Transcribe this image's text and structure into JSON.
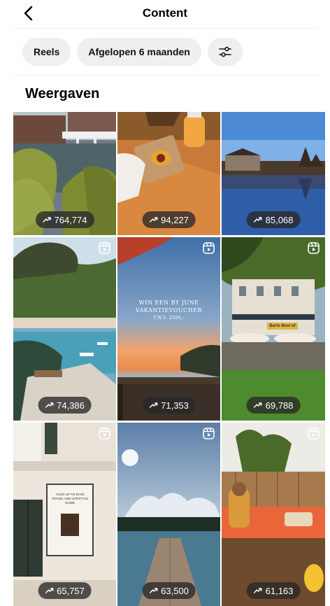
{
  "header": {
    "title": "Content",
    "back_icon": "chevron-left-icon"
  },
  "filters": {
    "content_type": "Reels",
    "period": "Afgelopen 6 maanden",
    "settings_icon": "sliders-icon"
  },
  "section": {
    "title": "Weergaven"
  },
  "trend_icon": "trending-up-icon",
  "reel_icon": "reel-icon",
  "tiles": [
    {
      "views": "764,774",
      "reel": false,
      "alt": "Canal with white bridge"
    },
    {
      "views": "94,227",
      "reel": false,
      "alt": "Orange drink and toast"
    },
    {
      "views": "85,068",
      "reel": false,
      "alt": "Castle reflected in lake"
    },
    {
      "views": "74,386",
      "reel": true,
      "alt": "Coastal bay with boats"
    },
    {
      "views": "71,353",
      "reel": true,
      "alt": "Sunset sea giveaway",
      "overlay_text": [
        "WIN EEN BY JUNE",
        "VAKANTIEVOUCHER",
        "T.W.V. 2500,-"
      ]
    },
    {
      "views": "69,788",
      "reel": true,
      "alt": "Cafe terrace under trees",
      "sign_text": "Barts Best of"
    },
    {
      "views": "65,757",
      "reel": true,
      "alt": "Building with poster",
      "poster_text": [
        "YOUR UP TO DATE",
        "TRAVEL AND LIFESTYLE",
        "GUIDE"
      ]
    },
    {
      "views": "63,500",
      "reel": true,
      "alt": "Wooden pier under clouds"
    },
    {
      "views": "61,163",
      "reel": true,
      "alt": "Woman on orange patio sofa"
    }
  ]
}
